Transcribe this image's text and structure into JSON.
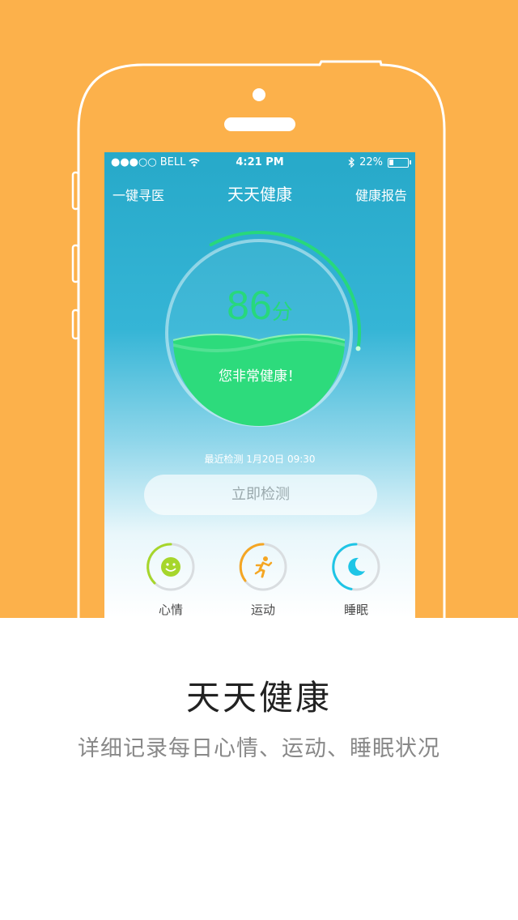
{
  "status_bar": {
    "carrier": "BELL",
    "time": "4:21 PM",
    "battery_text": "22%",
    "battery_level": 0.22
  },
  "nav": {
    "left_link": "一键寻医",
    "title": "天天健康",
    "right_link": "健康报告"
  },
  "score": {
    "value": "86",
    "unit": "分",
    "message": "您非常健康！",
    "fraction": 0.86
  },
  "last_check": "最近检测 1月20日 09:30",
  "detect_button": "立即检测",
  "categories": [
    {
      "label": "心情",
      "icon": "smiley-icon",
      "color": "#A6D62B"
    },
    {
      "label": "运动",
      "icon": "running-person-icon",
      "color": "#F5A623"
    },
    {
      "label": "睡眠",
      "icon": "moon-icon",
      "color": "#1EC5E6"
    }
  ],
  "caption": {
    "title": "天天健康",
    "subtitle": "详细记录每日心情、运动、睡眠状况"
  },
  "colors": {
    "background": "#FCB14B",
    "accent_green": "#27D87C",
    "screen_top": "#27A9C9"
  }
}
